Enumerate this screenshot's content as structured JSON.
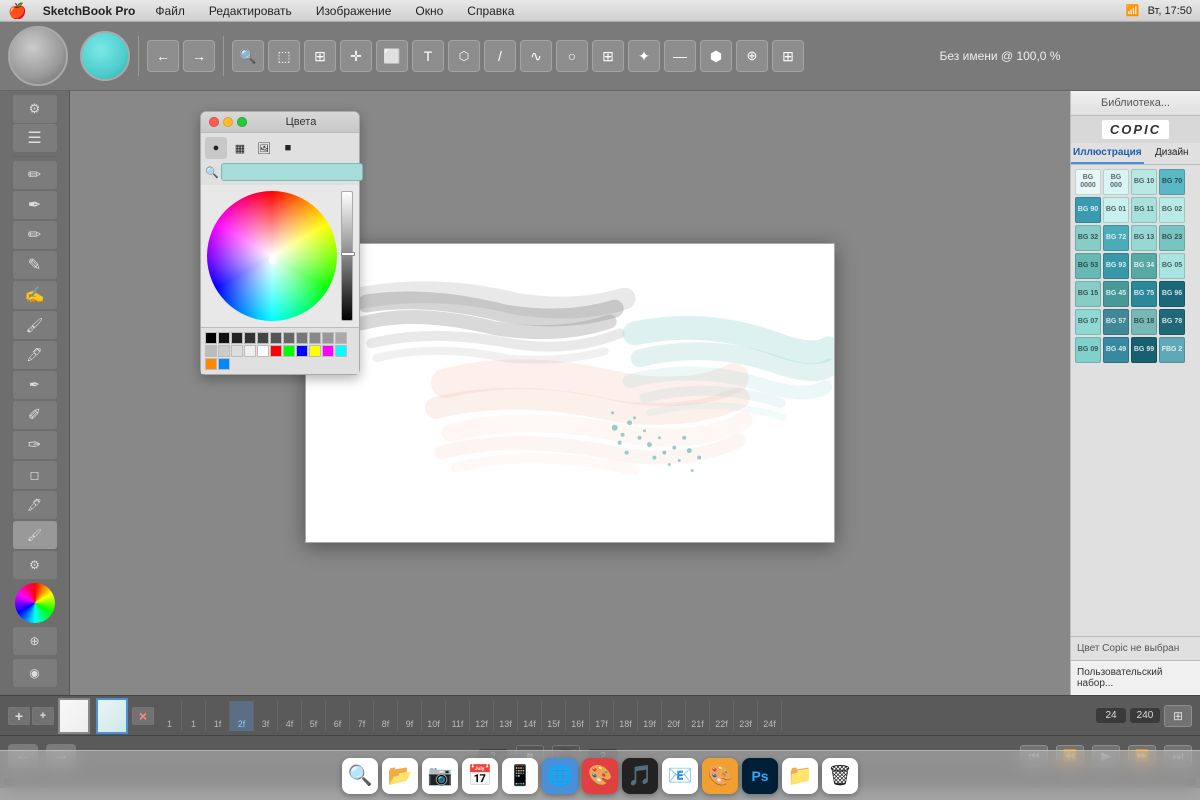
{
  "menubar": {
    "apple": "🍎",
    "app_name": "SketchBook Pro",
    "menus": [
      "Файл",
      "Редактировать",
      "Изображение",
      "Окно",
      "Справка"
    ],
    "title": "Без имени @ 100,0 %",
    "time": "Вт, 17:50"
  },
  "toolbar": {
    "buttons": [
      "←",
      "→",
      "🔍",
      "⬚",
      "⊞",
      "✛",
      "⬜",
      "T",
      "⬡",
      "⊘",
      "⊕",
      "⊘",
      "⊞",
      "✦",
      "✧",
      "◉",
      "⊞"
    ]
  },
  "color_panel": {
    "title": "Цвета",
    "search_placeholder": "",
    "tab_icons": [
      "●",
      "▦",
      "🖼",
      "■"
    ],
    "swatches": [
      "#000",
      "#111",
      "#222",
      "#333",
      "#444",
      "#555",
      "#666",
      "#777",
      "#888",
      "#999",
      "#aaa",
      "#bbb",
      "#ccc",
      "#ddd",
      "#eee",
      "#fff",
      "#f00",
      "#0f0",
      "#00f",
      "#ff0",
      "#f0f",
      "#0ff",
      "#f80",
      "#08f"
    ]
  },
  "copic": {
    "library_label": "Библиотека...",
    "logo": "COPIC",
    "tabs": [
      "Иллюстрация",
      "Дизайн"
    ],
    "active_tab": "Иллюстрация",
    "swatches": [
      {
        "code": "BG\n0000",
        "color": "#e8f8f8"
      },
      {
        "code": "BG\n000",
        "color": "#d8f4f4"
      },
      {
        "code": "BG\n10",
        "color": "#b8e8e4"
      },
      {
        "code": "BG\n70",
        "color": "#5ab8c4"
      },
      {
        "code": "BG\n90",
        "color": "#3a9ab0"
      },
      {
        "code": "BG\n01",
        "color": "#c8f0ec"
      },
      {
        "code": "BG\n11",
        "color": "#a8e0dc"
      },
      {
        "code": "BG\n02",
        "color": "#b8eae6"
      },
      {
        "code": "BG\n32",
        "color": "#88ccc8"
      },
      {
        "code": "BG\n72",
        "color": "#4aacb8"
      },
      {
        "code": "BG\n13",
        "color": "#98d8d4"
      },
      {
        "code": "BG\n23",
        "color": "#78c4c0"
      },
      {
        "code": "BG\n53",
        "color": "#68b8b4"
      },
      {
        "code": "BG\n93",
        "color": "#3898a8"
      },
      {
        "code": "BG\n34",
        "color": "#58a8a4"
      },
      {
        "code": "BG\n05",
        "color": "#a8e4e0"
      },
      {
        "code": "BG\n15",
        "color": "#88ccc8"
      },
      {
        "code": "BG\n45",
        "color": "#489898"
      },
      {
        "code": "BG\n75",
        "color": "#2a8898"
      },
      {
        "code": "BG\n96",
        "color": "#1a6878"
      },
      {
        "code": "BG\n07",
        "color": "#90d8d4"
      },
      {
        "code": "BG\n57",
        "color": "#408898"
      },
      {
        "code": "BG\n18",
        "color": "#78b8b4"
      },
      {
        "code": "BG\n78",
        "color": "#206878"
      },
      {
        "code": "BG\n09",
        "color": "#80d0cc"
      },
      {
        "code": "BG\n49",
        "color": "#3888a0"
      },
      {
        "code": "BG\n99",
        "color": "#186070"
      },
      {
        "code": "FBG\n2",
        "color": "#60a8b8"
      }
    ],
    "status": "Цвет Copic не выбран",
    "custom_set": "Пользовательский набор..."
  },
  "timeline": {
    "frames": [
      "1",
      "1",
      "1f",
      "2f",
      "3f",
      "4f",
      "5f",
      "6f",
      "7f",
      "8f",
      "9f",
      "10f",
      "11f",
      "12f",
      "13f",
      "14f",
      "15f",
      "16f",
      "17f",
      "18f",
      "19f",
      "20f",
      "21f",
      "22f",
      "23f",
      "24f"
    ],
    "end_frame": "240",
    "current": "24",
    "add_label": "+",
    "add2_label": "+",
    "remove_label": "×",
    "playback_speed": "2",
    "playback_speed2": "2"
  },
  "left_panel": {
    "tools": [
      "⚙",
      "☰",
      "✏",
      "✏",
      "✏",
      "✏",
      "✏",
      "✏",
      "✏",
      "✏",
      "✏",
      "✏",
      "✏",
      "✏",
      "✏",
      "✏",
      "✏",
      "✏"
    ]
  },
  "dock": {
    "icons": [
      "🔍",
      "🗂",
      "📷",
      "📅",
      "📱",
      "🌐",
      "🔴",
      "🎵",
      "📧",
      "🎨",
      "💻",
      "📁",
      "🗑"
    ]
  }
}
